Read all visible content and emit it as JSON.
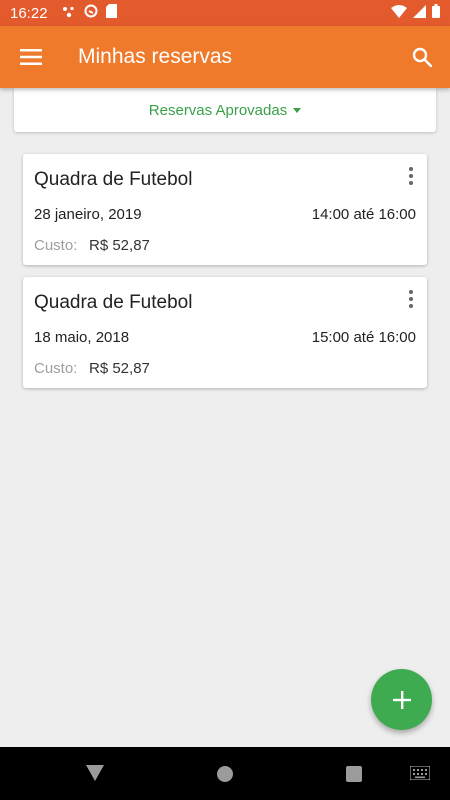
{
  "status_bar": {
    "time": "16:22",
    "left_icons": [
      "notification-dots-icon",
      "at-sign-icon",
      "sd-card-icon"
    ],
    "right_icons": [
      "wifi-icon",
      "cellular-signal-icon",
      "battery-icon"
    ]
  },
  "app_bar": {
    "title": "Minhas reservas",
    "menu_icon": "hamburger-menu-icon",
    "search_icon": "search-icon",
    "color": "#f07a2c"
  },
  "filter": {
    "label": "Reservas Aprovadas",
    "color": "#3aa14a"
  },
  "bookings": [
    {
      "title": "Quadra de Futebol",
      "date": "28 janeiro, 2019",
      "time": "14:00 até 16:00",
      "cost_label": "Custo:",
      "cost_value": "R$ 52,87"
    },
    {
      "title": "Quadra de Futebol",
      "date": "18 maio, 2018",
      "time": "15:00 até 16:00",
      "cost_label": "Custo:",
      "cost_value": "R$ 52,87"
    }
  ],
  "fab": {
    "icon": "plus-icon",
    "color": "#3eab50"
  },
  "nav_bar": {
    "icons": [
      "back-icon",
      "home-icon",
      "recents-icon",
      "keyboard-icon"
    ]
  }
}
